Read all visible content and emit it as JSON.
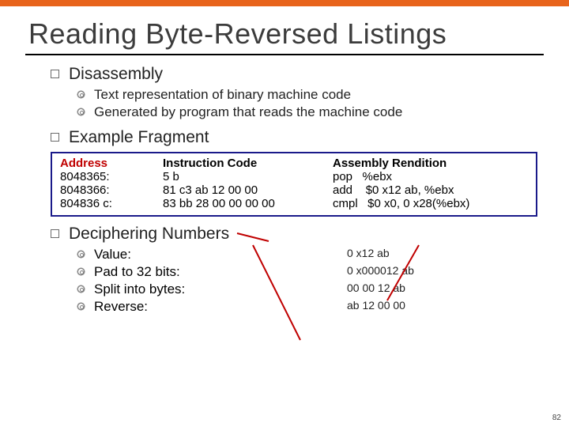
{
  "title": "Reading Byte-Reversed Listings",
  "sections": {
    "s1": {
      "heading": "Disassembly",
      "items": [
        "Text representation of binary machine code",
        "Generated by program that reads the machine code"
      ]
    },
    "s2": {
      "heading": "Example Fragment"
    },
    "table": {
      "h1": "Address",
      "h2": "Instruction Code",
      "h3": "Assembly Rendition",
      "rows": [
        {
          "a": "8048365:",
          "b": "5 b",
          "c": "pop   %ebx"
        },
        {
          "a": "8048366:",
          "b": "81 c3 ab 12 00 00",
          "c": "add    $0 x12 ab, %ebx"
        },
        {
          "a": "804836 c:",
          "b": "83 bb 28 00 00 00 00",
          "c": "cmpl   $0 x0, 0 x28(%ebx)"
        }
      ]
    },
    "s3": {
      "heading": "Deciphering Numbers",
      "items": [
        {
          "label": "Value:",
          "val": "0 x12 ab"
        },
        {
          "label": "Pad to 32 bits:",
          "val": "0 x000012 ab"
        },
        {
          "label": "Split into bytes:",
          "val": "00 00 12 ab"
        },
        {
          "label": "Reverse:",
          "val": "ab 12 00 00"
        }
      ]
    }
  },
  "pagenum": "82"
}
